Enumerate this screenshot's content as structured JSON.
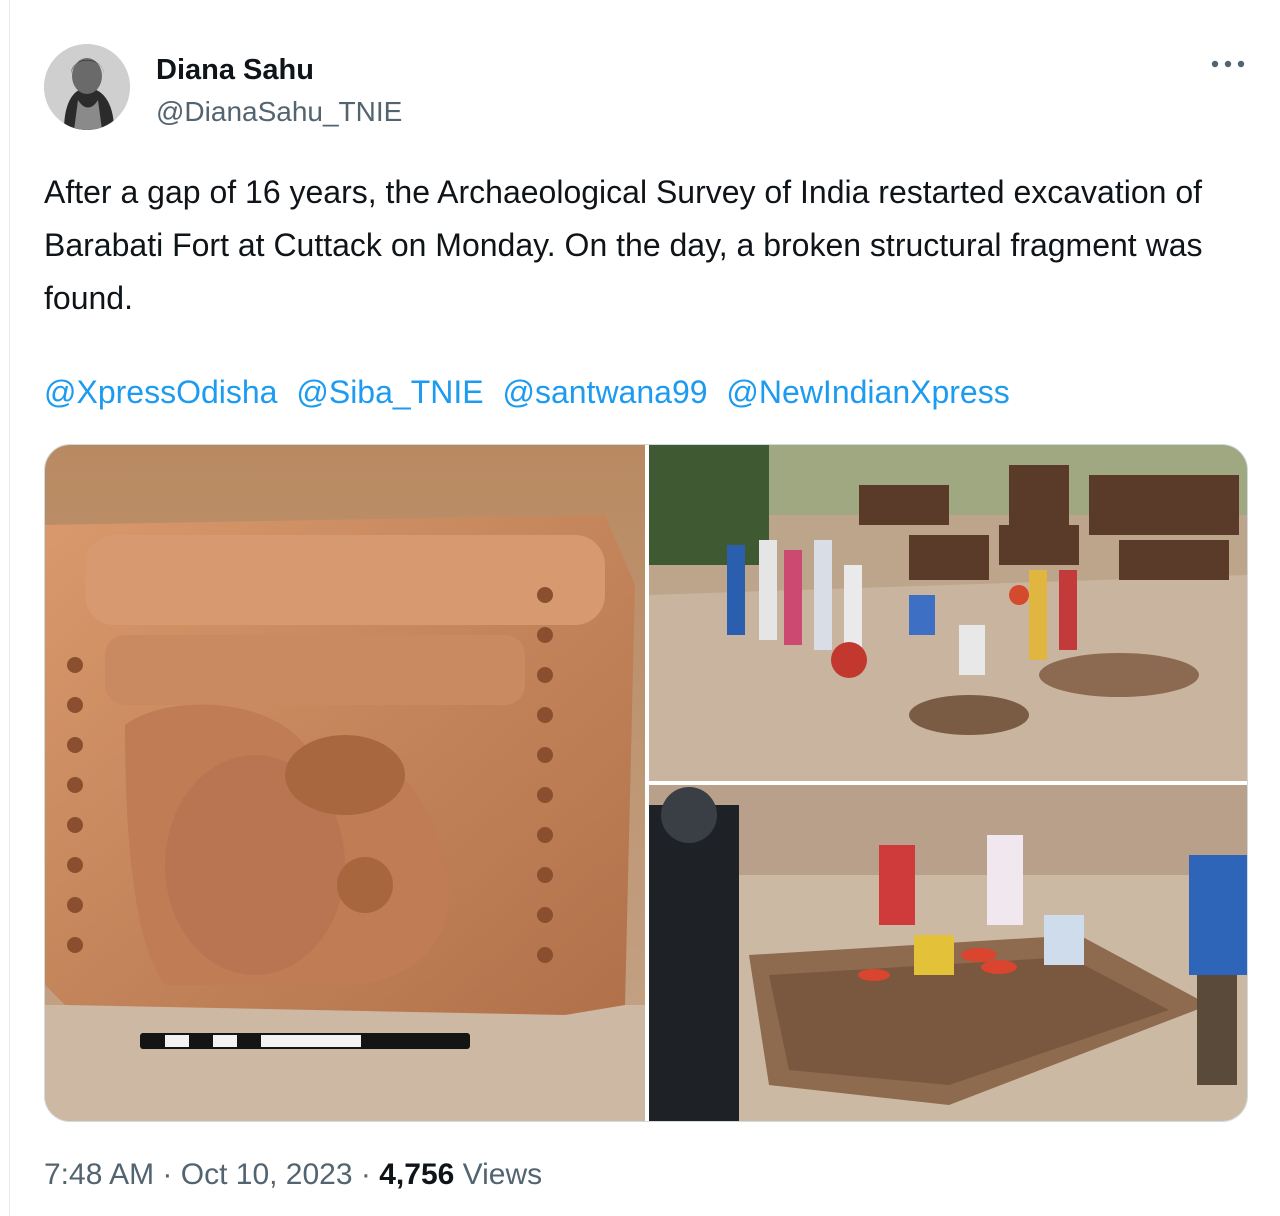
{
  "author": {
    "name": "Diana Sahu",
    "handle": "@DianaSahu_TNIE"
  },
  "more_icon": "more-horizontal-icon",
  "tweet": {
    "text": "After a gap of 16 years, the Archaeological Survey of India restarted excavation of Barabati Fort at Cuttack on Monday. On the day, a broken structural fragment was found.",
    "mentions": [
      "@XpressOdisha",
      "@Siba_TNIE",
      "@santwana99",
      "@NewIndianXpress"
    ]
  },
  "meta": {
    "time": "7:48 AM",
    "separator": "·",
    "date": "Oct 10, 2023",
    "views_count": "4,756",
    "views_label": "Views"
  },
  "colors": {
    "link": "#1d9bf0",
    "secondary_text": "#536471",
    "primary_text": "#0f1419"
  }
}
